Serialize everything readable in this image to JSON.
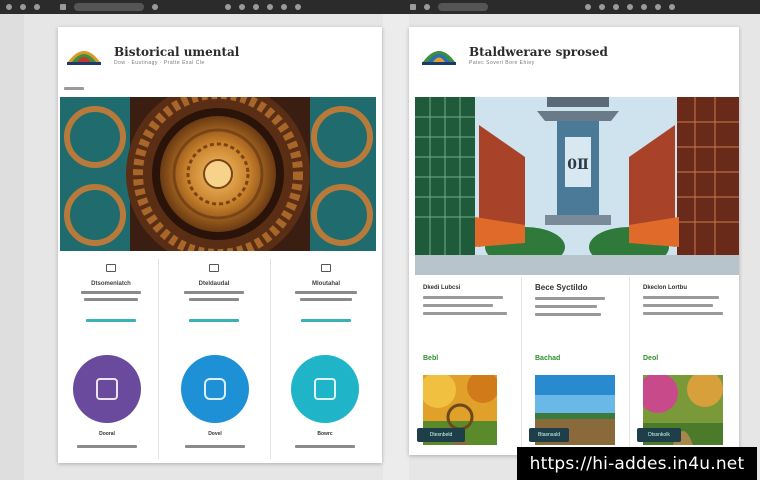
{
  "left_page": {
    "site_title": "Bistorical umental",
    "site_sub": "Dow · Eustinagy · Pratte Exal Cle",
    "columns": [
      {
        "title": "Dtsomenlatch",
        "caption": "Dooral"
      },
      {
        "title": "Dteldaudal",
        "caption": "Dovel"
      },
      {
        "title": "Mloutahal",
        "caption": "Bowrc"
      }
    ]
  },
  "right_page": {
    "site_title": "Btaldwerare sprosed",
    "site_sub": "Patec Soverl Bore Ehiey",
    "columns": [
      {
        "title": "Dkedi Lubcsi",
        "green_label": "Bebl",
        "button": "Dtesnbeld"
      },
      {
        "title": "Bece Syctildo",
        "green_label": "Bachad",
        "button": "Btasnsald"
      },
      {
        "title": "Dkeclon Lortbu",
        "green_label": "Deol",
        "button": "Dtssnkolk"
      }
    ]
  },
  "colors": {
    "circle_purple": "#6a4a9c",
    "circle_blue": "#1e90d6",
    "circle_teal": "#1fb4c8",
    "button_dark": "#1e3e4a",
    "green_text": "#2f8f2f"
  },
  "watermark": "https://hi-addes.in4u.net"
}
